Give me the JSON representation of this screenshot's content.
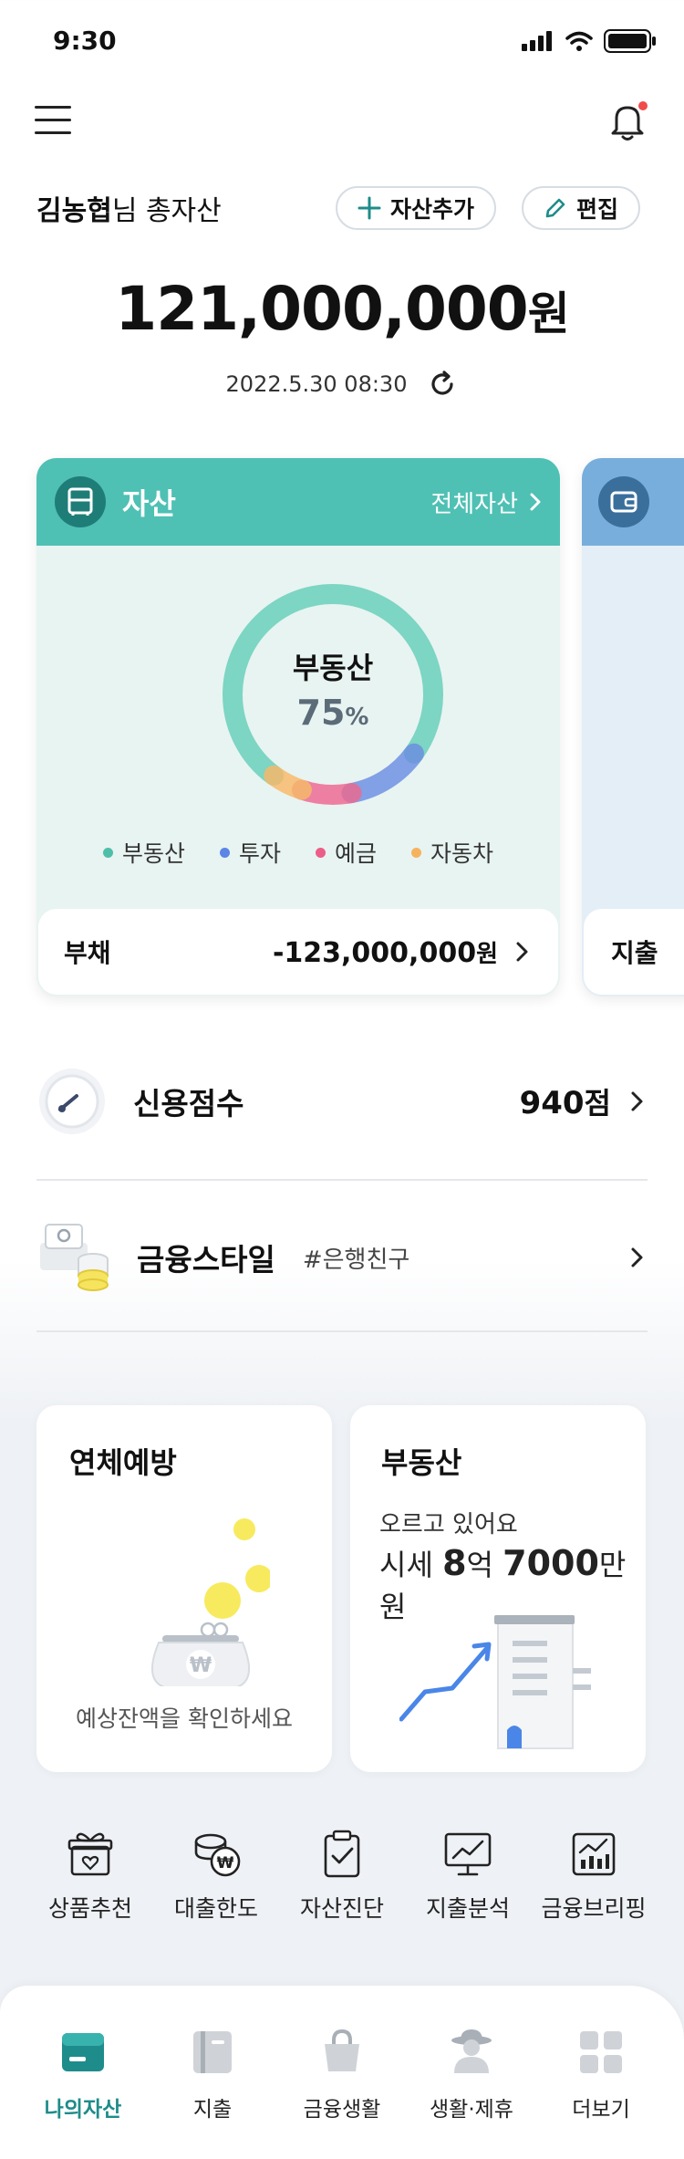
{
  "status_bar": {
    "time": "9:30"
  },
  "header": {
    "user_name": "김농협",
    "greeting_suffix": "님 총자산",
    "add_asset_label": "자산추가",
    "edit_label": "편집"
  },
  "summary": {
    "total_amount": "121,000,000",
    "currency_unit": "원",
    "updated_at": "2022.5.30 08:30"
  },
  "asset_card": {
    "title": "자산",
    "all_assets_link": "전체자산",
    "donut_center_label": "부동산",
    "donut_center_value": "75",
    "donut_center_unit": "%",
    "breakdown": [
      {
        "name": "부동산",
        "share": 0.75,
        "color": "#6fd0bd"
      },
      {
        "name": "투자",
        "share": 0.12,
        "color": "#6b8fe0"
      },
      {
        "name": "예금",
        "share": 0.08,
        "color": "#ea6a92"
      },
      {
        "name": "자동차",
        "share": 0.05,
        "color": "#f4b86a"
      }
    ],
    "legend": [
      {
        "label": "부동산",
        "color": "#4dbfa9"
      },
      {
        "label": "투자",
        "color": "#5b86e6"
      },
      {
        "label": "예금",
        "color": "#ec5d87"
      },
      {
        "label": "자동차",
        "color": "#f6b35e"
      }
    ],
    "debt_label": "부채",
    "debt_amount": "-123,000,000",
    "debt_unit": "원"
  },
  "peek_card": {
    "bottom_label": "지출"
  },
  "credit": {
    "label": "신용점수",
    "score": "940",
    "score_unit": "점"
  },
  "finance_style": {
    "label": "금융스타일",
    "tag": "#은행친구"
  },
  "tiles": {
    "overdue": {
      "title": "연체예방",
      "bottom": "예상잔액을 확인하세요"
    },
    "real_estate": {
      "title": "부동산",
      "sub": "오르고 있어요",
      "price_prefix": "시세 ",
      "price_num1": "8",
      "price_mid": "억 ",
      "price_num2": "7000",
      "price_suffix": "만원"
    }
  },
  "quick_menu": [
    {
      "label": "상품추천",
      "icon": "gift-icon"
    },
    {
      "label": "대출한도",
      "icon": "coins-icon"
    },
    {
      "label": "자산진단",
      "icon": "clipboard-check-icon"
    },
    {
      "label": "지출분석",
      "icon": "chart-monitor-icon"
    },
    {
      "label": "금융브리핑",
      "icon": "report-chart-icon"
    }
  ],
  "bottom_nav": [
    {
      "label": "나의자산",
      "icon": "wallet-icon",
      "active": true
    },
    {
      "label": "지출",
      "icon": "book-icon",
      "active": false
    },
    {
      "label": "금융생활",
      "icon": "bag-icon",
      "active": false
    },
    {
      "label": "생활·제휴",
      "icon": "person-hat-icon",
      "active": false
    },
    {
      "label": "더보기",
      "icon": "grid-icon",
      "active": false
    }
  ],
  "colors": {
    "accent": "#4fc0b4",
    "accent_dark": "#1e8c8a",
    "peek": "#78aedb"
  }
}
